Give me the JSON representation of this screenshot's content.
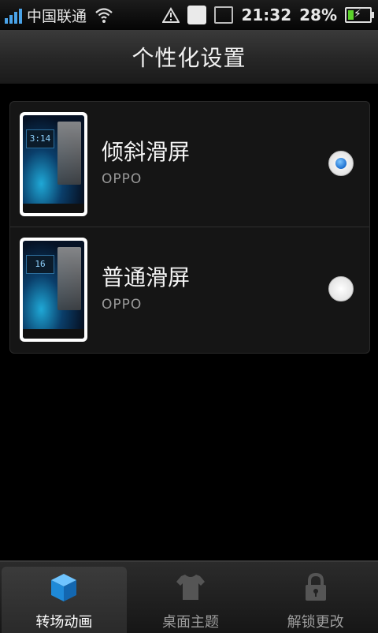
{
  "status_bar": {
    "carrier": "中国联通",
    "time": "21:32",
    "battery_percent": "28%",
    "battery_level": 0.28,
    "signal_bars": 4
  },
  "header": {
    "title": "个性化设置"
  },
  "options": [
    {
      "title": "倾斜滑屏",
      "subtitle": "OPPO",
      "selected": true,
      "thumb_clock": "3:14"
    },
    {
      "title": "普通滑屏",
      "subtitle": "OPPO",
      "selected": false,
      "thumb_clock": "16"
    }
  ],
  "tabs": [
    {
      "label": "转场动画",
      "icon": "cube-icon",
      "active": true
    },
    {
      "label": "桌面主题",
      "icon": "shirt-icon",
      "active": false
    },
    {
      "label": "解锁更改",
      "icon": "lock-icon",
      "active": false
    }
  ],
  "colors": {
    "accent": "#2a8fd8",
    "battery": "#5cd22b"
  }
}
